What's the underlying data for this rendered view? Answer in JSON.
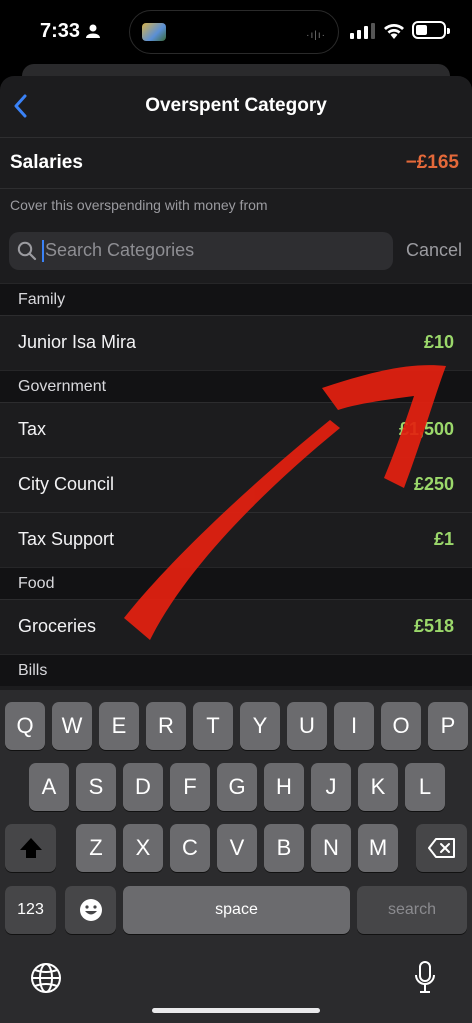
{
  "status": {
    "time": "7:33"
  },
  "nav": {
    "title": "Overspent Category"
  },
  "overspent": {
    "name": "Salaries",
    "amount": "−£165",
    "hint": "Cover this overspending with money from"
  },
  "search": {
    "placeholder": "Search Categories",
    "cancel": "Cancel"
  },
  "sections": [
    {
      "title": "Family",
      "items": [
        {
          "label": "Junior Isa Mira",
          "amount": "£10"
        }
      ]
    },
    {
      "title": "Government",
      "items": [
        {
          "label": "Tax",
          "amount": "£1,500"
        },
        {
          "label": "City Council",
          "amount": "£250"
        },
        {
          "label": "Tax Support",
          "amount": "£1"
        }
      ]
    },
    {
      "title": "Food",
      "items": [
        {
          "label": "Groceries",
          "amount": "£518"
        }
      ]
    },
    {
      "title": "Bills",
      "items": []
    }
  ],
  "colors": {
    "overspent": "#e4693a",
    "available": "#9bd86b",
    "annotation": "#e32010",
    "accent": "#3a82f7"
  },
  "keyboard": {
    "row1": [
      "Q",
      "W",
      "E",
      "R",
      "T",
      "Y",
      "U",
      "I",
      "O",
      "P"
    ],
    "row2": [
      "A",
      "S",
      "D",
      "F",
      "G",
      "H",
      "J",
      "K",
      "L"
    ],
    "row3": [
      "Z",
      "X",
      "C",
      "V",
      "B",
      "N",
      "M"
    ],
    "numbers": "123",
    "space": "space",
    "action": "search"
  },
  "icons": [
    "person-icon",
    "back-chevron-icon",
    "search-icon",
    "shift-icon",
    "backspace-icon",
    "emoji-icon",
    "globe-icon",
    "microphone-icon"
  ]
}
